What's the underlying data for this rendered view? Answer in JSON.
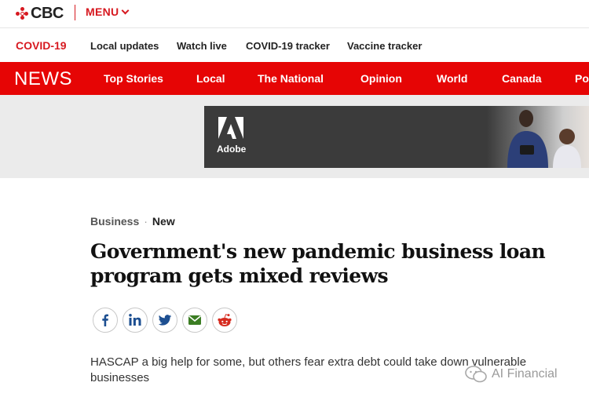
{
  "brand": {
    "logo_text": "CBC",
    "menu_label": "MENU"
  },
  "covid_bar": {
    "title": "COVID-19",
    "links": [
      "Local updates",
      "Watch live",
      "COVID-19 tracker",
      "Vaccine tracker"
    ]
  },
  "news_nav": {
    "section": "NEWS",
    "items": [
      "Top Stories",
      "Local",
      "The National",
      "Opinion",
      "World",
      "Canada",
      "Po"
    ]
  },
  "ad": {
    "brand_text": "Adobe"
  },
  "article": {
    "section": "Business",
    "separator": "·",
    "badge": "New",
    "headline": "Government's new pandemic business loan program gets mixed reviews",
    "deck": "HASCAP a big help for some, but others fear extra debt could take down vulnerable businesses"
  },
  "share": {
    "icons": [
      "facebook-icon",
      "linkedin-icon",
      "twitter-icon",
      "email-icon",
      "reddit-icon"
    ]
  },
  "watermark": {
    "text": "AI Financial"
  },
  "colors": {
    "cbc_red": "#e60505",
    "text_dark": "#111111",
    "ad_bg": "#3b3b3b",
    "band_gray": "#ebebeb"
  }
}
